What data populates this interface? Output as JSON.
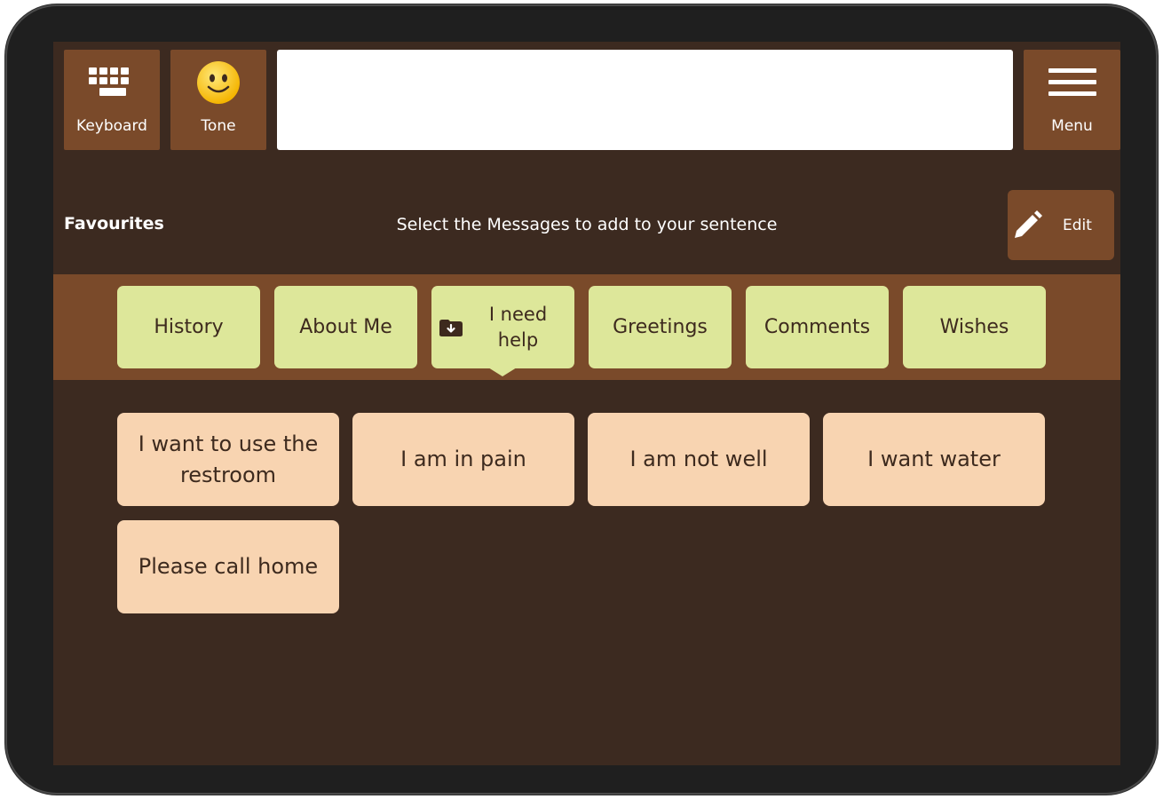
{
  "toolbar": {
    "keyboard_label": "Keyboard",
    "tone_label": "Tone",
    "menu_label": "Menu",
    "sentence_value": ""
  },
  "header": {
    "section_title": "Favourites",
    "instruction": "Select the Messages to add to your sentence",
    "edit_label": "Edit"
  },
  "categories": [
    {
      "label": "History"
    },
    {
      "label": "About Me"
    },
    {
      "label": "I need help",
      "selected": true,
      "icon": "folder-download-icon"
    },
    {
      "label": "Greetings"
    },
    {
      "label": "Comments"
    },
    {
      "label": "Wishes"
    }
  ],
  "messages": [
    {
      "label": "I want to use the restroom"
    },
    {
      "label": "I am in pain"
    },
    {
      "label": "I am not well"
    },
    {
      "label": "I want water"
    },
    {
      "label": "Please call home"
    }
  ],
  "colors": {
    "background": "#3c2a20",
    "panel": "#7a4a2a",
    "category_tile": "#dde79a",
    "message_tile": "#f8d4b1",
    "text_dark": "#3d2a1e"
  }
}
